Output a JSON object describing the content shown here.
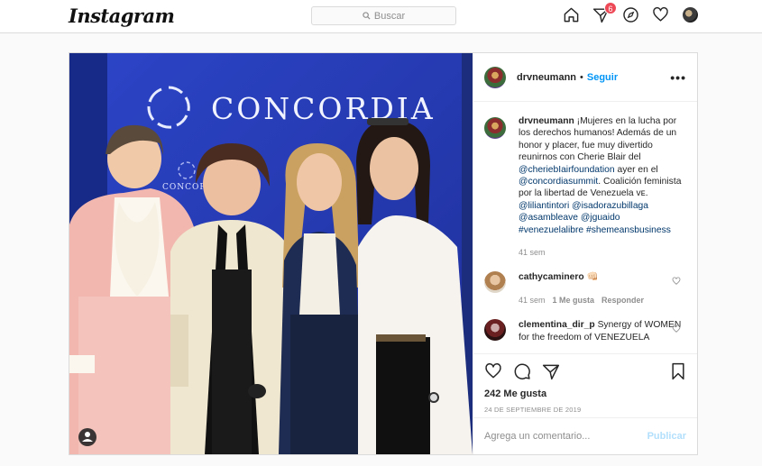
{
  "nav": {
    "logo": "Instagram",
    "search_placeholder": "Buscar",
    "notifications_count": "6",
    "icons": [
      "home-icon",
      "direct-icon",
      "explore-icon",
      "activity-heart-icon",
      "profile-avatar"
    ]
  },
  "post": {
    "photo_text": "CONCORDIA",
    "photo_text_small": "CONCORDIA",
    "header": {
      "username": "drvneumann",
      "dot": "•",
      "follow": "Seguir",
      "more": "•••"
    },
    "caption": {
      "username": "drvneumann",
      "text_1": " ¡Mujeres en la lucha por los derechos humanos! Además de un honor y placer, fue muy divertido reunirnos con Cherie Blair del ",
      "mention_1": "@cheriebIairfoundation",
      "text_2": " ayer en el ",
      "mention_2": "@concordiasummit",
      "text_3": ". Coalición feminista por la libertad de Venezuela ᴠᴇ. ",
      "mention_3": "@liliantintori",
      "text_4": " ",
      "mention_4": "@isadorazubillaga",
      "text_5": " ",
      "mention_5": "@asambleave",
      "text_6": " ",
      "mention_6": "@jguaido",
      "text_7": " ",
      "hashtag_1": "#venezuelalibre",
      "text_8": " ",
      "hashtag_2": "#shemeansbusiness",
      "time": "41 sem"
    },
    "comments": [
      {
        "username": "cathycaminero",
        "text": " 👊🏻",
        "time": "41 sem",
        "likes": "1 Me gusta",
        "reply": "Responder"
      },
      {
        "username": "clementina_dir_p",
        "text": " Synergy of WOMEN for the freedom of VENEZUELA"
      }
    ],
    "likes": "242 Me gusta",
    "date": "24 DE SEPTIEMBRE DE 2019",
    "add_comment_placeholder": "Agrega un comentario...",
    "publish": "Publicar"
  },
  "colors": {
    "accent": "#0095f6",
    "link": "#00376b",
    "badge": "#ed4956",
    "banner_blue": "#2a3fb8"
  }
}
